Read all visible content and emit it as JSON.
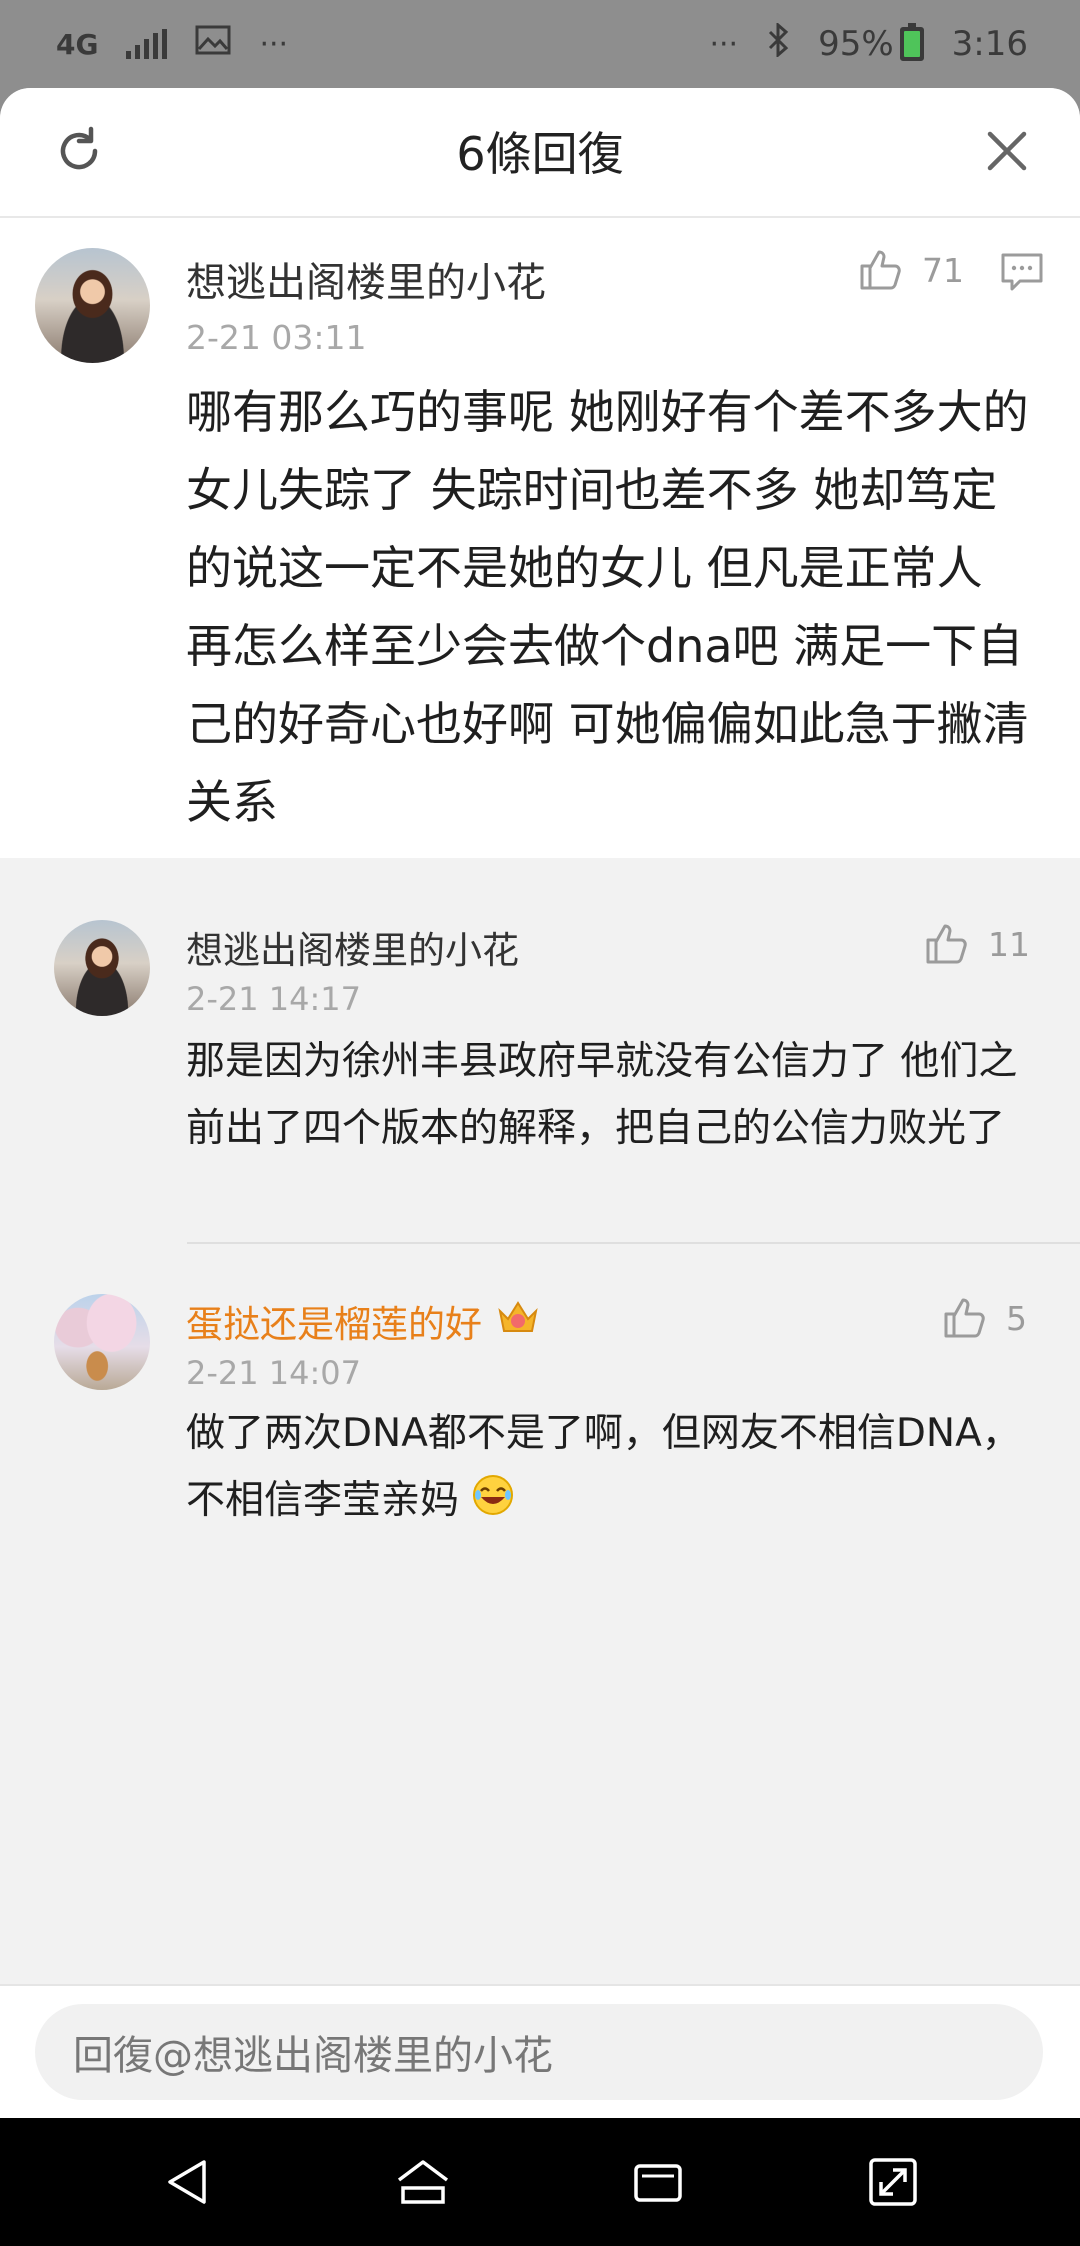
{
  "status_bar": {
    "network": "4G",
    "battery": "95%",
    "time": "3:16",
    "icons": [
      "signal-icon",
      "gallery-icon",
      "more-dots-icon",
      "bluetooth-icon",
      "battery-icon"
    ]
  },
  "sheet": {
    "title": "6條回復"
  },
  "main_comment": {
    "username": "想逃出阁楼里的小花",
    "time": "2-21 03:11",
    "likes": "71",
    "text": "哪有那么巧的事呢 她刚好有个差不多大的女儿失踪了 失踪时间也差不多 她却笃定的说这一定不是她的女儿 但凡是正常人 再怎么样至少会去做个dna吧 满足一下自己的好奇心也好啊 可她偏偏如此急于撇清关系"
  },
  "replies": [
    {
      "username": "想逃出阁楼里的小花",
      "time": "2-21 14:17",
      "likes": "11",
      "text": "那是因为徐州丰县政府早就没有公信力了 他们之前出了四个版本的解释，把自己的公信力败光了"
    },
    {
      "username": "蛋挞还是榴莲的好",
      "time": "2-21 14:07",
      "likes": "5",
      "text": "做了两次DNA都不是了啊，但网友不相信DNA，不相信李莹亲妈"
    }
  ],
  "reply_bar": {
    "placeholder": "回復@想逃出阁楼里的小花"
  },
  "colors": {
    "vip_name": "#e8801a",
    "timestamp": "#a8a8a8",
    "background": "#f2f2f2"
  }
}
